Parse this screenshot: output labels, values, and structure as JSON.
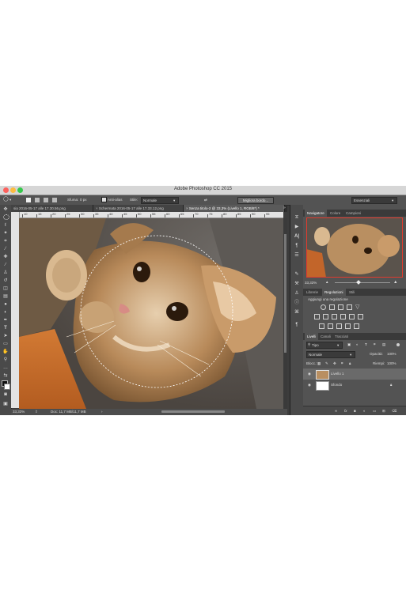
{
  "window": {
    "title": "Adobe Photoshop CC 2015"
  },
  "options_bar": {
    "feather_label": "Sfuma:",
    "feather_value": "0 px",
    "antialias_label": "Anti-alias",
    "style_label": "Stile:",
    "style_value": "Normale",
    "refine_edge_button": "Migliora bordo...",
    "workspace_value": "Essenziali"
  },
  "tabs": [
    {
      "label": "sia 2016-05-17 alle 17.30.56.png"
    },
    {
      "label": "Schermata 2016-05-17 alle 17.33.12.png"
    },
    {
      "label": "Senza titolo-2 @ 33,3% (Livello 1, RGB/8*) *"
    }
  ],
  "ruler_top": [
    "10",
    "15",
    "20",
    "25",
    "30",
    "35",
    "40",
    "45",
    "50",
    "55",
    "60",
    "65",
    "70",
    "75",
    "80",
    "85",
    "90",
    "95"
  ],
  "status": {
    "zoom": "33,33%",
    "doc": "Doc: 11,7 MB/11,7 MB"
  },
  "navigator": {
    "tabs": [
      "Navigatore",
      "Colore",
      "Campioni"
    ],
    "zoom": "33,33%"
  },
  "adjustments": {
    "tabs": [
      "Librerie",
      "Regolazioni",
      "Stili"
    ],
    "hint": "Aggiungi una regolazione"
  },
  "layers": {
    "tabs": [
      "Livelli",
      "Canali",
      "Tracciati"
    ],
    "kind_filter": "Tipo",
    "blend_mode": "Normale",
    "opacity_label": "Opacità:",
    "opacity_value": "100%",
    "lock_label": "Blocc.:",
    "fill_label": "Riempi:",
    "fill_value": "100%",
    "items": [
      {
        "name": "Livello 1"
      },
      {
        "name": "Sfondo"
      }
    ]
  },
  "colors": {
    "titlebar": "#d6d6d6",
    "panel_bg": "#535353",
    "accent_close": "#fc605c",
    "accent_min": "#fdbc40",
    "accent_max": "#34c84a",
    "layer_selected": "#6a6a6a"
  }
}
